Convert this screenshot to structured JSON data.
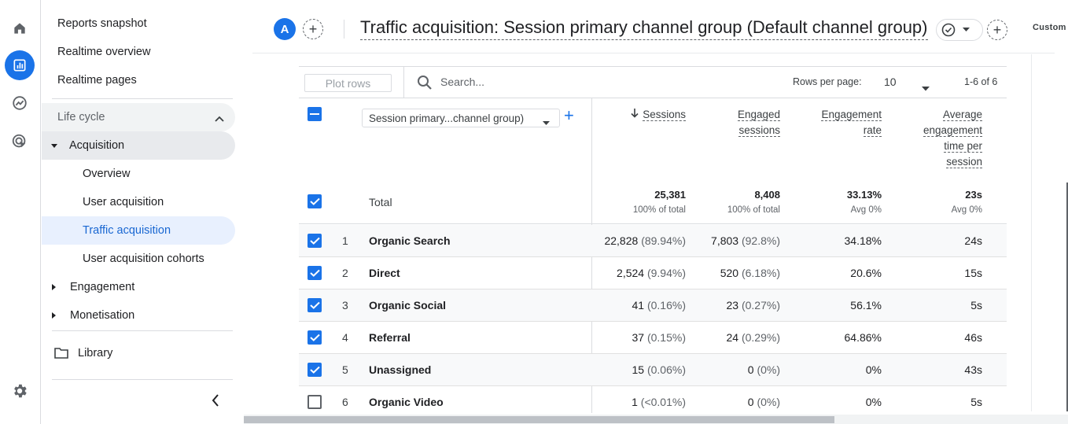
{
  "rail": {
    "icons": [
      "home-icon",
      "reports-icon",
      "explore-icon",
      "advertising-icon",
      "settings-icon"
    ]
  },
  "nav": {
    "top_items": [
      "Reports snapshot",
      "Realtime overview",
      "Realtime pages"
    ],
    "section": "Life cycle",
    "acquisition": "Acquisition",
    "acq_children": [
      "Overview",
      "User acquisition",
      "Traffic acquisition",
      "User acquisition cohorts"
    ],
    "engagement": "Engagement",
    "monetisation": "Monetisation",
    "library": "Library"
  },
  "header": {
    "avatar_letter": "A",
    "title": "Traffic acquisition: Session primary channel group (Default channel group)",
    "custom": "Custom"
  },
  "toolbar": {
    "plot_rows": "Plot rows",
    "search_placeholder": "Search...",
    "rows_per_page_label": "Rows per page:",
    "rows_per_page_value": "10",
    "pager": "1-6 of 6"
  },
  "table": {
    "dimension_select": "Session primary...channel group)",
    "columns": {
      "sessions": "Sessions",
      "engaged_1": "Engaged",
      "engaged_2": "sessions",
      "rate_1": "Engagement",
      "rate_2": "rate",
      "avg_1": "Average",
      "avg_2": "engagement",
      "avg_3": "time per",
      "avg_4": "session"
    },
    "total": {
      "label": "Total",
      "sessions": "25,381",
      "sessions_sub": "100% of total",
      "engaged": "8,408",
      "engaged_sub": "100% of total",
      "rate": "33.13%",
      "rate_sub": "Avg 0%",
      "avg": "23s",
      "avg_sub": "Avg 0%"
    },
    "rows": [
      {
        "n": "1",
        "label": "Organic Search",
        "sessions": "22,828",
        "sessions_pct": "(89.94%)",
        "engaged": "7,803",
        "engaged_pct": "(92.8%)",
        "rate": "34.18%",
        "avg": "24s",
        "checked": true
      },
      {
        "n": "2",
        "label": "Direct",
        "sessions": "2,524",
        "sessions_pct": "(9.94%)",
        "engaged": "520",
        "engaged_pct": "(6.18%)",
        "rate": "20.6%",
        "avg": "15s",
        "checked": true
      },
      {
        "n": "3",
        "label": "Organic Social",
        "sessions": "41",
        "sessions_pct": "(0.16%)",
        "engaged": "23",
        "engaged_pct": "(0.27%)",
        "rate": "56.1%",
        "avg": "5s",
        "checked": true
      },
      {
        "n": "4",
        "label": "Referral",
        "sessions": "37",
        "sessions_pct": "(0.15%)",
        "engaged": "24",
        "engaged_pct": "(0.29%)",
        "rate": "64.86%",
        "avg": "46s",
        "checked": true
      },
      {
        "n": "5",
        "label": "Unassigned",
        "sessions": "15",
        "sessions_pct": "(0.06%)",
        "engaged": "0",
        "engaged_pct": "(0%)",
        "rate": "0%",
        "avg": "43s",
        "checked": true
      },
      {
        "n": "6",
        "label": "Organic Video",
        "sessions": "1",
        "sessions_pct": "(<0.01%)",
        "engaged": "0",
        "engaged_pct": "(0%)",
        "rate": "0%",
        "avg": "5s",
        "checked": false
      }
    ]
  },
  "colors": {
    "accent": "#1a73e8",
    "selected_bg": "#e8f0fe",
    "selected_text": "#1967d2"
  }
}
